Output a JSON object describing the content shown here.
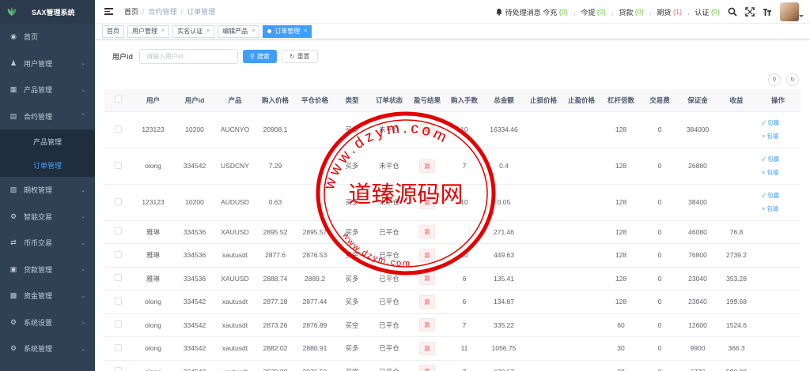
{
  "app": {
    "title": "SAX管理系统"
  },
  "sidebar": {
    "items": [
      {
        "label": "首页",
        "icon": "dashboard-icon",
        "arrow": false
      },
      {
        "label": "用户管理",
        "icon": "user-icon",
        "arrow": true
      },
      {
        "label": "产品管理",
        "icon": "document-icon",
        "arrow": true
      },
      {
        "label": "合约管理",
        "icon": "clipboard-icon",
        "arrow": true,
        "open": true
      },
      {
        "label": "期权管理",
        "icon": "chart-icon",
        "arrow": true
      },
      {
        "label": "智能交易",
        "icon": "gear-icon",
        "arrow": true
      },
      {
        "label": "币币交易",
        "icon": "exchange-icon",
        "arrow": true
      },
      {
        "label": "贷款管理",
        "icon": "wallet-icon",
        "arrow": true
      },
      {
        "label": "资金管理",
        "icon": "money-icon",
        "arrow": true
      },
      {
        "label": "系统设置",
        "icon": "settings-icon",
        "arrow": true
      },
      {
        "label": "系统管理",
        "icon": "cog-icon",
        "arrow": true
      }
    ],
    "sub": [
      {
        "label": "产品管理"
      },
      {
        "label": "订单管理",
        "active": true
      }
    ]
  },
  "breadcrumb": {
    "home": "首页",
    "level1": "合约管理",
    "level2": "订单管理"
  },
  "header": {
    "pending": "待处理消息",
    "today_charge": "今充",
    "today_charge_n": "(0)",
    "today_withdraw": "今提",
    "today_withdraw_n": "(0)",
    "loan": "贷款",
    "loan_n": "(0)",
    "futures": "期货",
    "futures_n": "(1)",
    "verify": "认证",
    "verify_n": "(0)"
  },
  "tabs": [
    {
      "label": "首页"
    },
    {
      "label": "用户管理"
    },
    {
      "label": "实名认证"
    },
    {
      "label": "编辑产品"
    },
    {
      "label": "订单管理",
      "active": true
    }
  ],
  "search": {
    "label": "用户id",
    "placeholder": "请输入用户id",
    "search_btn": "搜索",
    "reset_btn": "重置"
  },
  "table": {
    "headers": [
      "",
      "用户",
      "用户id",
      "产品",
      "购入价格",
      "平仓价格",
      "类型",
      "订单状态",
      "盈亏结果",
      "购入手数",
      "总金额",
      "止损价格",
      "止盈价格",
      "杠杆倍数",
      "交易费",
      "保证金",
      "收益",
      "操作"
    ],
    "rows": [
      {
        "h": "tall",
        "cells": [
          "",
          "123123",
          "10200",
          "AUCNYO",
          "20908.1",
          "",
          "买多",
          "未平仓",
          "赢",
          "10",
          "16334.46",
          "",
          "",
          "128",
          "0",
          "384000",
          ""
        ],
        "ops": true
      },
      {
        "h": "tall",
        "cells": [
          "",
          "olong",
          "334542",
          "USDCNY",
          "7.29",
          "",
          "买多",
          "未平仓",
          "赢",
          "7",
          "0.4",
          "",
          "",
          "128",
          "0",
          "26880",
          ""
        ],
        "ops": true
      },
      {
        "h": "tall",
        "cells": [
          "",
          "123123",
          "10200",
          "AUDUSD",
          "0.63",
          "",
          "买多",
          "未平仓",
          "赢",
          "10",
          "0.05",
          "",
          "",
          "128",
          "0",
          "38400",
          ""
        ],
        "ops": true
      },
      {
        "h": "short",
        "cells": [
          "",
          "雅琳",
          "334536",
          "XAUUSD",
          "2895.52",
          "2895.57",
          "买多",
          "已平仓",
          "赢",
          "",
          "271.46",
          "",
          "",
          "128",
          "0",
          "46080",
          "76.8"
        ]
      },
      {
        "h": "short",
        "cells": [
          "",
          "雅琳",
          "334536",
          "xautusdt",
          "2877.6",
          "2876.53",
          "买空",
          "已平仓",
          "赢",
          "20",
          "449.63",
          "",
          "",
          "128",
          "0",
          "76800",
          "2739.2"
        ]
      },
      {
        "h": "short",
        "cells": [
          "",
          "雅琳",
          "334536",
          "XAUUSD",
          "2888.74",
          "2889.2",
          "买多",
          "已平仓",
          "赢",
          "6",
          "135.41",
          "",
          "",
          "128",
          "0",
          "23040",
          "353.28"
        ]
      },
      {
        "h": "short",
        "cells": [
          "",
          "olong",
          "334542",
          "xautusdt",
          "2877.18",
          "2877.44",
          "买多",
          "已平仓",
          "赢",
          "6",
          "134.87",
          "",
          "",
          "128",
          "0",
          "23040",
          "199.68"
        ]
      },
      {
        "h": "short",
        "cells": [
          "",
          "olong",
          "334542",
          "xautusdt",
          "2873.26",
          "2876.89",
          "买空",
          "已平仓",
          "赢",
          "7",
          "335.22",
          "",
          "",
          "60",
          "0",
          "12600",
          "1524.6"
        ]
      },
      {
        "h": "short",
        "cells": [
          "",
          "olong",
          "334542",
          "xautusdt",
          "2882.02",
          "2880.91",
          "买多",
          "已平仓",
          "赢",
          "11",
          "1056.75",
          "",
          "",
          "30",
          "0",
          "9900",
          "366.3"
        ]
      },
      {
        "h": "short",
        "cells": [
          "",
          "olong",
          "334542",
          "xautusdt",
          "2873.92",
          "2876.59",
          "买空",
          "已平仓",
          "赢",
          "7",
          "628.67",
          "",
          "",
          "32",
          "0",
          "6720",
          "598.08"
        ]
      }
    ],
    "op_labels": {
      "win": "包赢",
      "lose": "包输"
    }
  },
  "watermark": {
    "text": "道臻源码网",
    "top": "www.dzym.com",
    "bottom": "www.dzym.com"
  }
}
